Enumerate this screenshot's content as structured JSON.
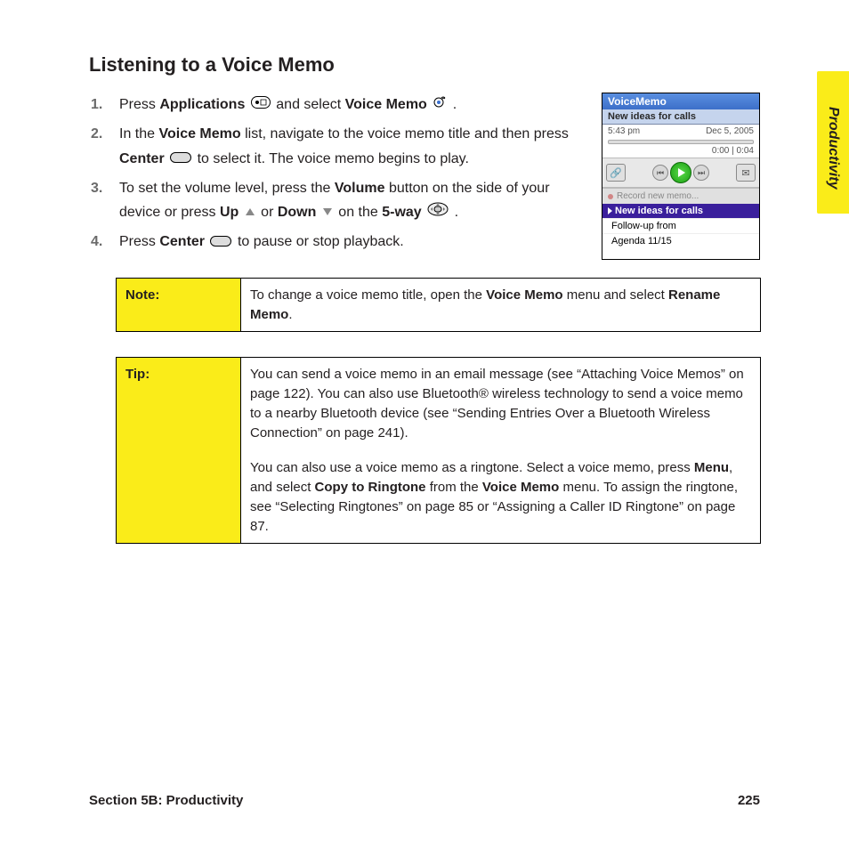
{
  "side_tab": "Productivity",
  "heading": "Listening to a Voice Memo",
  "steps": {
    "s1": {
      "t1": "Press ",
      "b1": "Applications",
      "t2": " and select ",
      "b2": "Voice Memo",
      "t3": " ."
    },
    "s2": {
      "t1": "In the ",
      "b1": "Voice Memo",
      "t2": " list, navigate to the voice memo title and then press ",
      "b2": "Center",
      "t3": " to select it. The voice memo begins to play."
    },
    "s3": {
      "t1": "To set the volume level, press the ",
      "b1": "Volume",
      "t2": " button on the side of your device or press ",
      "b2": "Up",
      "t3": " or ",
      "b3": "Down",
      "t4": " on the ",
      "b4": "5-way",
      "t5": " ."
    },
    "s4": {
      "t1": "Press ",
      "b1": "Center",
      "t2": " to pause or stop playback."
    }
  },
  "note": {
    "label": "Note:",
    "t1": "To change a voice memo title, open the ",
    "b1": "Voice Memo",
    "t2": " menu and select ",
    "b2": "Rename Memo",
    "t3": "."
  },
  "tip": {
    "label": "Tip:",
    "p1": "You can send a voice memo in an email message (see “Attaching Voice Memos” on page 122). You can also use Bluetooth® wireless technology to send a voice memo to a nearby Bluetooth device (see “Sending Entries Over a Bluetooth Wireless Connection” on page 241).",
    "p2a": "You can also use a voice memo as a ringtone. Select a voice memo, press ",
    "p2b1": "Menu",
    "p2c": ", and select ",
    "p2b2": "Copy to Ringtone",
    "p2d": " from the ",
    "p2b3": "Voice Memo",
    "p2e": " menu. To assign the ringtone, see “Selecting Ringtones” on page 85 or “Assigning a Caller ID Ringtone” on page 87."
  },
  "screenshot": {
    "title": "VoiceMemo",
    "current": "New ideas for calls",
    "time": "5:43 pm",
    "date": "Dec 5, 2005",
    "pos": "0:00",
    "dur": "0:04",
    "record": "Record new memo...",
    "selected": "New ideas for calls",
    "item1": "Follow-up from",
    "item2": "Agenda 11/15"
  },
  "footer": {
    "section": "Section 5B: Productivity",
    "page": "225"
  }
}
